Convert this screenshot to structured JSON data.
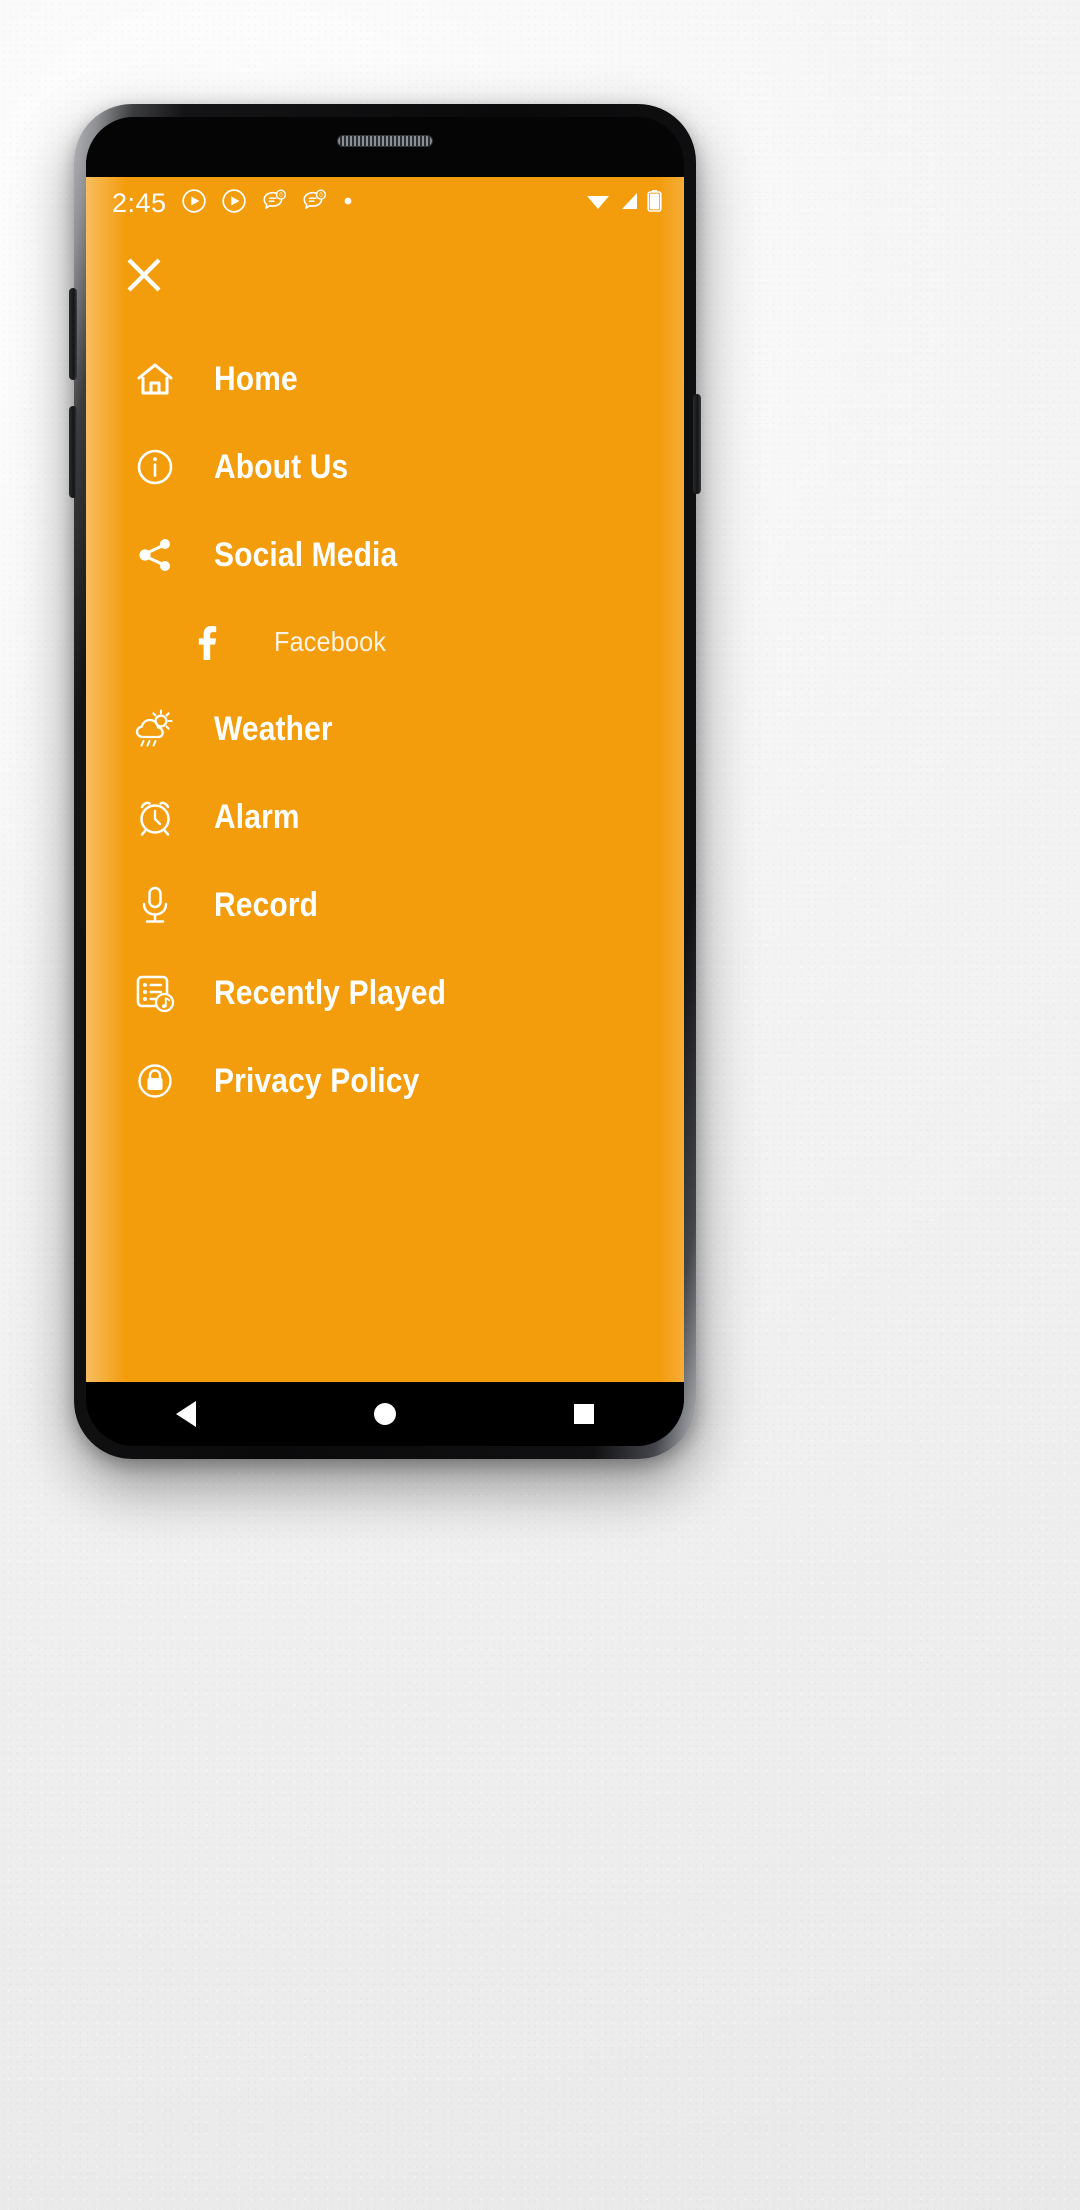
{
  "device": {
    "name": "samsung-galaxy-s8-mockup",
    "body_color": "#0a0a0b",
    "screen_bg": "#000000"
  },
  "statusbar": {
    "clock": "2:45",
    "left_icons": [
      "play-circle-icon",
      "play-circle-icon",
      "message-badge-icon",
      "message-badge-icon",
      "dot-icon"
    ],
    "badge_count": "0",
    "right_icons": [
      "wifi-icon",
      "signal-icon",
      "battery-icon"
    ]
  },
  "drawer": {
    "background_color": "#f39c0c",
    "text_color": "#ffffff",
    "close_label": "close-icon",
    "items": [
      {
        "id": "home",
        "label": "Home",
        "icon": "home-icon",
        "sub": false
      },
      {
        "id": "about-us",
        "label": "About Us",
        "icon": "info-icon",
        "sub": false
      },
      {
        "id": "social-media",
        "label": "Social Media",
        "icon": "share-icon",
        "sub": false
      },
      {
        "id": "facebook",
        "label": "Facebook",
        "icon": "facebook-icon",
        "sub": true
      },
      {
        "id": "weather",
        "label": "Weather",
        "icon": "weather-icon",
        "sub": false
      },
      {
        "id": "alarm",
        "label": "Alarm",
        "icon": "alarm-icon",
        "sub": false
      },
      {
        "id": "record",
        "label": "Record",
        "icon": "microphone-icon",
        "sub": false
      },
      {
        "id": "recently-played",
        "label": "Recently Played",
        "icon": "playlist-icon",
        "sub": false
      },
      {
        "id": "privacy-policy",
        "label": "Privacy Policy",
        "icon": "lock-icon",
        "sub": false
      }
    ]
  },
  "navbar": {
    "back_label": "back-button",
    "home_label": "home-button",
    "recents_label": "recents-button"
  }
}
